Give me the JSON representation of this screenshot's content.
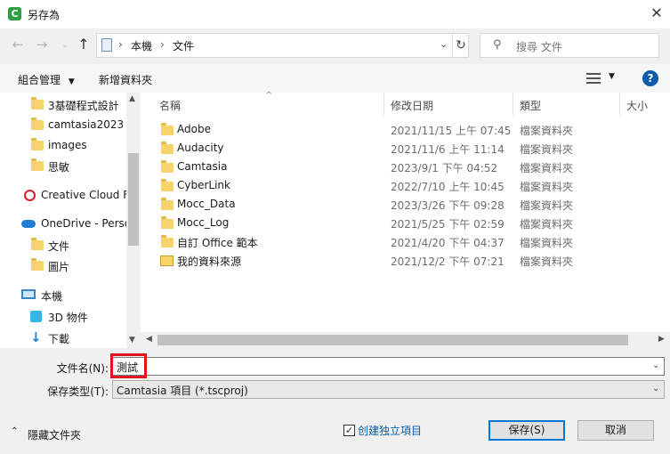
{
  "window": {
    "title": "另存為",
    "app_icon_letter": "C"
  },
  "address": {
    "crumbs": [
      "本機",
      "文件"
    ]
  },
  "search": {
    "placeholder": "搜尋 文件"
  },
  "toolbar": {
    "organize": "組合管理",
    "new_folder": "新增資料夾"
  },
  "nav_items": [
    {
      "label": "3基礎程式設計",
      "icon": "folder-icon"
    },
    {
      "label": "camtasia2023",
      "icon": "folder-icon"
    },
    {
      "label": "images",
      "icon": "folder-icon"
    },
    {
      "label": "思敏",
      "icon": "folder-icon"
    },
    {
      "label": "Creative Cloud Fi",
      "icon": "creative-cloud-icon"
    },
    {
      "label": "OneDrive - Perso",
      "icon": "onedrive-icon"
    },
    {
      "label": "文件",
      "icon": "folder-icon"
    },
    {
      "label": "圖片",
      "icon": "folder-icon"
    },
    {
      "label": "本機",
      "icon": "computer-icon"
    },
    {
      "label": "3D 物件",
      "icon": "3d-objects-icon"
    },
    {
      "label": "下載",
      "icon": "download-icon"
    }
  ],
  "columns": {
    "name": "名稱",
    "date": "修改日期",
    "type": "類型",
    "size": "大小"
  },
  "files": [
    {
      "name": "Adobe",
      "date": "2021/11/15 上午 07:45",
      "type": "檔案資料夾"
    },
    {
      "name": "Audacity",
      "date": "2021/11/6 上午 11:14",
      "type": "檔案資料夾"
    },
    {
      "name": "Camtasia",
      "date": "2023/9/1 下午 04:52",
      "type": "檔案資料夾"
    },
    {
      "name": "CyberLink",
      "date": "2022/7/10 上午 10:45",
      "type": "檔案資料夾"
    },
    {
      "name": "Mocc_Data",
      "date": "2023/3/26 下午 09:28",
      "type": "檔案資料夾"
    },
    {
      "name": "Mocc_Log",
      "date": "2021/5/25 下午 02:59",
      "type": "檔案資料夾"
    },
    {
      "name": "自訂 Office 範本",
      "date": "2021/4/20 下午 04:37",
      "type": "檔案資料夾"
    },
    {
      "name": "我的資料來源",
      "date": "2021/12/2 下午 07:21",
      "type": "檔案資料夾"
    }
  ],
  "form": {
    "filename_label": "文件名(N):",
    "filename_value": "測試",
    "filetype_label": "保存类型(T):",
    "filetype_value": "Camtasia 項目 (*.tscproj)"
  },
  "footer": {
    "hide_folders": "隱藏文件夾",
    "create_project_folder": "创建独立項目",
    "save": "保存(S)",
    "cancel": "取消"
  },
  "colors": {
    "highlight": "#e0141e",
    "accent": "#0078d7"
  }
}
